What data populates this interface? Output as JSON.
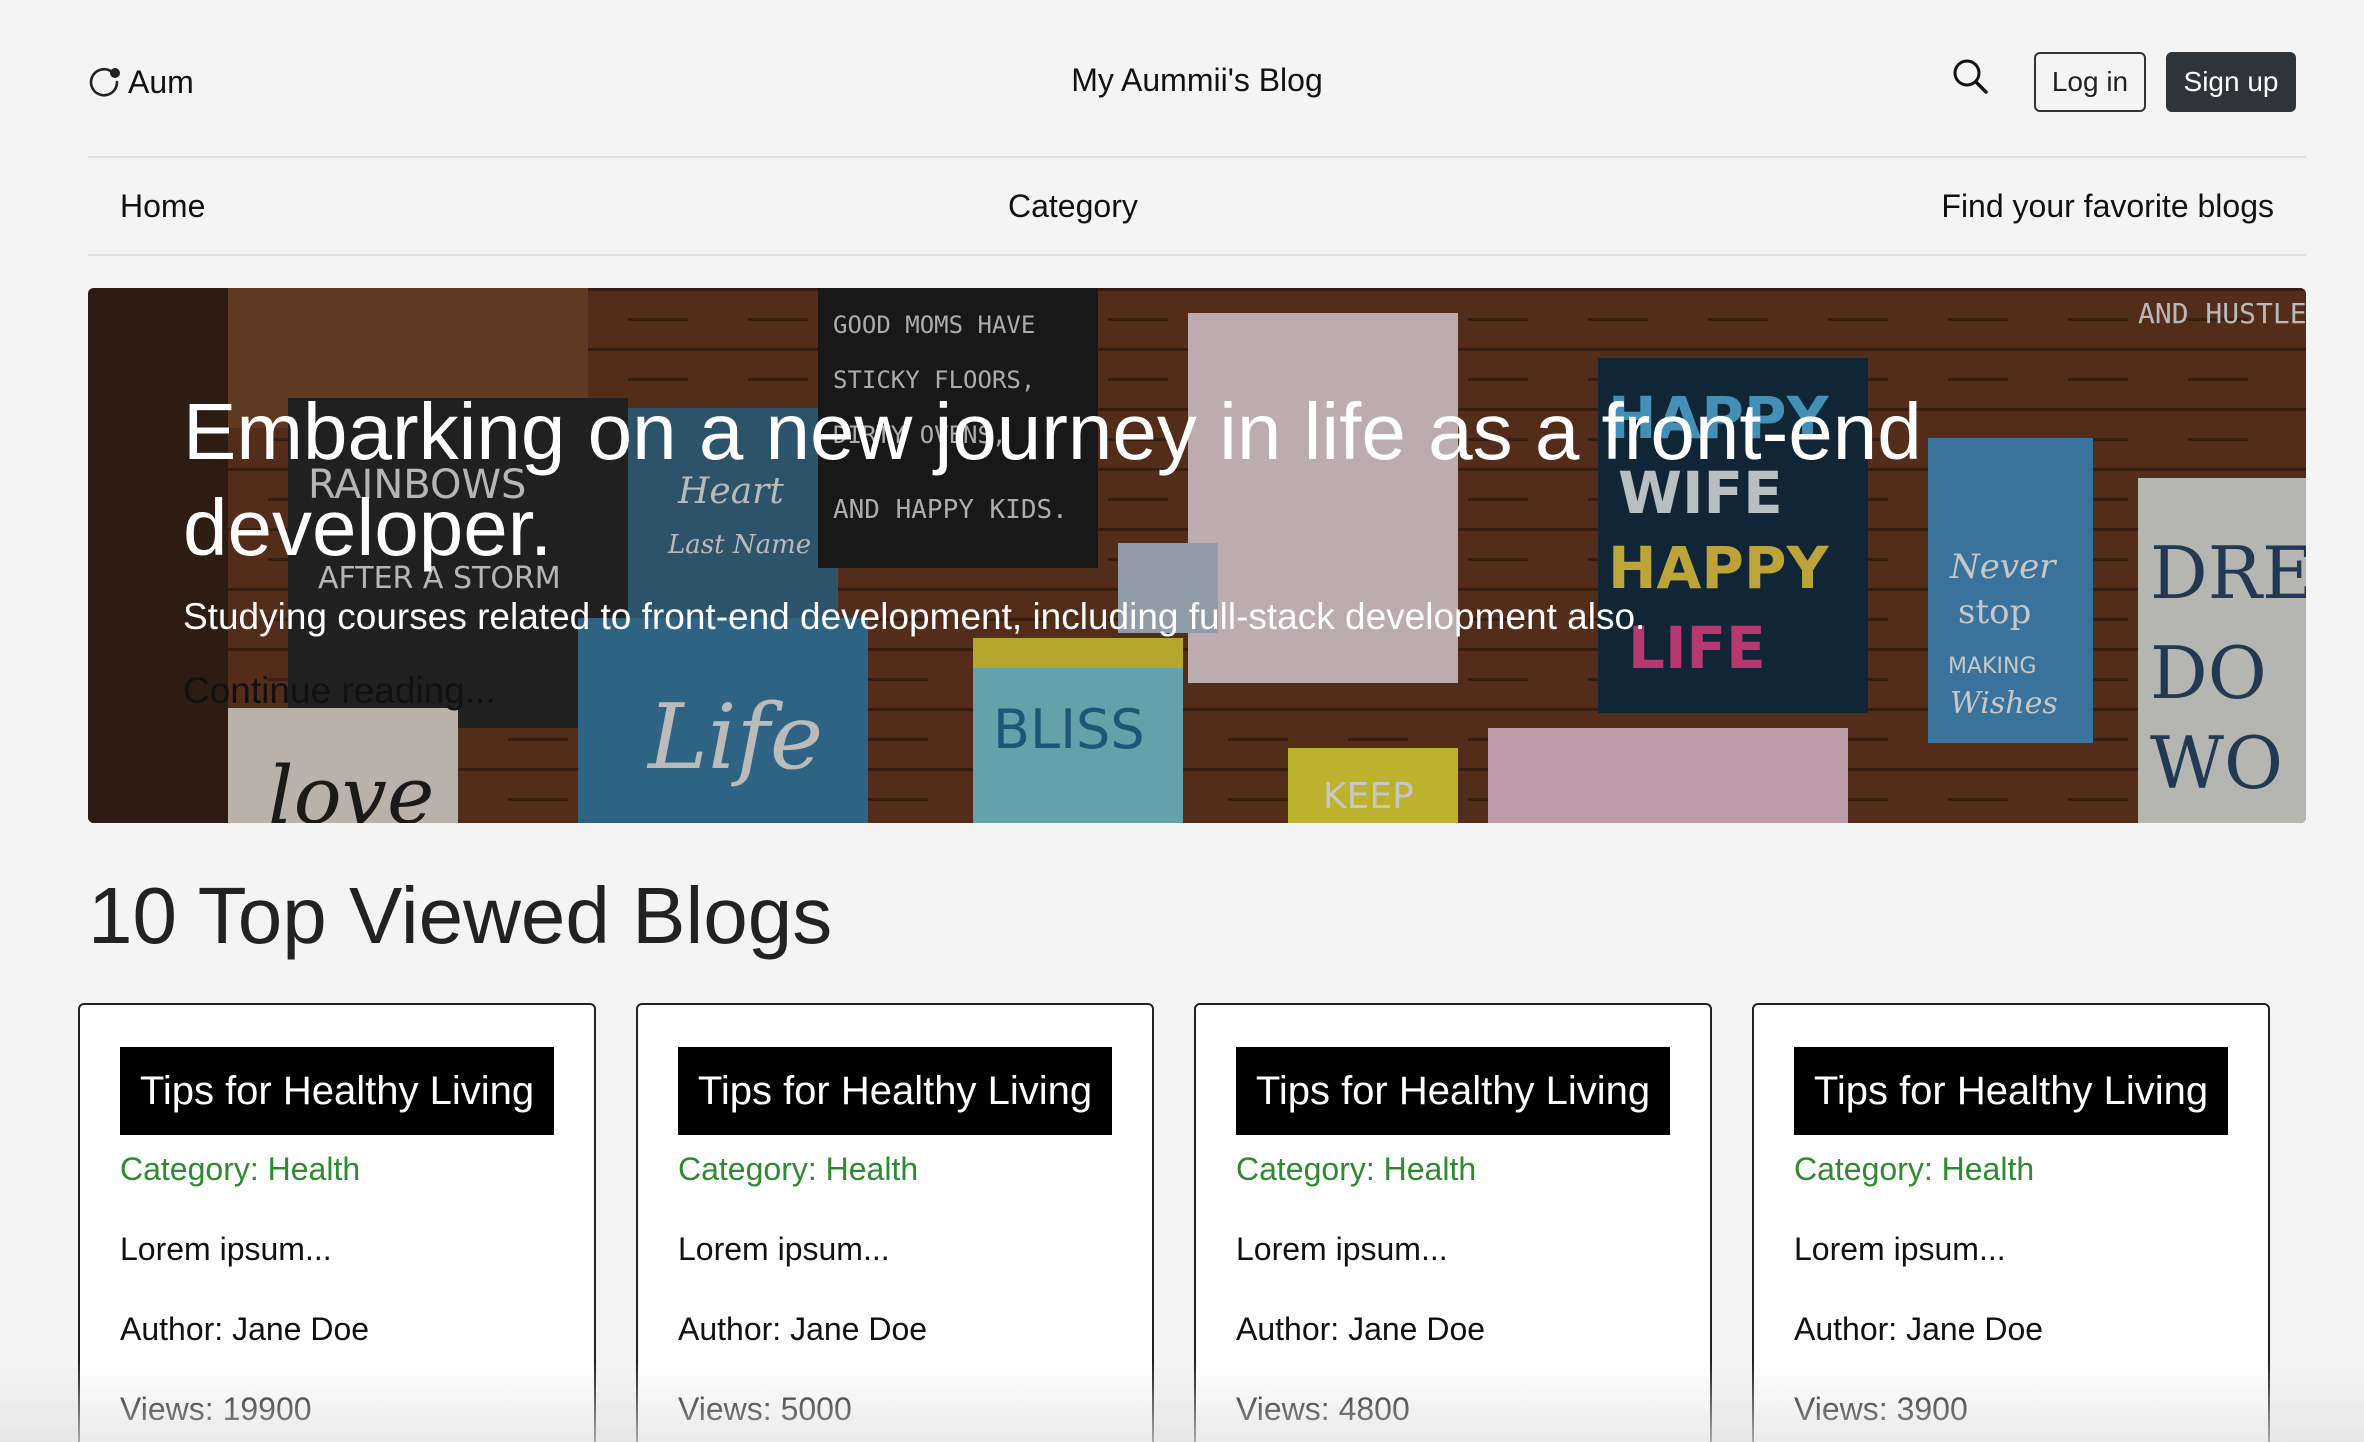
{
  "header": {
    "logo_text": "Aum",
    "site_title": "My Aummii's Blog",
    "login_label": "Log in",
    "signup_label": "Sign up"
  },
  "nav": {
    "items": [
      {
        "label": "Home"
      },
      {
        "label": "Category"
      },
      {
        "label": "Find your favorite blogs"
      }
    ]
  },
  "hero": {
    "title": "Embarking on a new journey in life as a front-end developer.",
    "subtitle": "Studying courses related to front-end development, including full-stack development also.",
    "link_label": "Continue reading...",
    "image_signs": [
      "GOOD MOMS HAVE STICKY FLOORS, DIRTY OVENS, AND HAPPY KIDS.",
      "RAINBOWS",
      "AFTER A STORM",
      "Heart",
      "Last Name",
      "HAPPY WIFE HAPPY LIFE",
      "Never stop MAKING Wishes",
      "FIND BLISS IN BLOOMS",
      "Life",
      "love",
      "KEEP",
      "AND HUSTLE",
      "DRE DO WO"
    ]
  },
  "section": {
    "title": "10 Top Viewed Blogs"
  },
  "cards": [
    {
      "title": "Tips for Healthy Living",
      "category": "Category: Health",
      "excerpt": "Lorem ipsum...",
      "author": "Author: Jane Doe",
      "views": "Views: 19900"
    },
    {
      "title": "Tips for Healthy Living",
      "category": "Category: Health",
      "excerpt": "Lorem ipsum...",
      "author": "Author: Jane Doe",
      "views": "Views: 5000"
    },
    {
      "title": "Tips for Healthy Living",
      "category": "Category: Health",
      "excerpt": "Lorem ipsum...",
      "author": "Author: Jane Doe",
      "views": "Views: 4800"
    },
    {
      "title": "Tips for Healthy Living",
      "category": "Category: Health",
      "excerpt": "Lorem ipsum...",
      "author": "Author: Jane Doe",
      "views": "Views: 3900"
    }
  ],
  "colors": {
    "page_bg": "#f4f4f4",
    "signup_bg": "#2f3438",
    "card_title_bg": "#000000",
    "category_green": "#2e8a2e"
  },
  "icons": {
    "logo": "chat-bubble-icon",
    "search": "search-icon"
  }
}
